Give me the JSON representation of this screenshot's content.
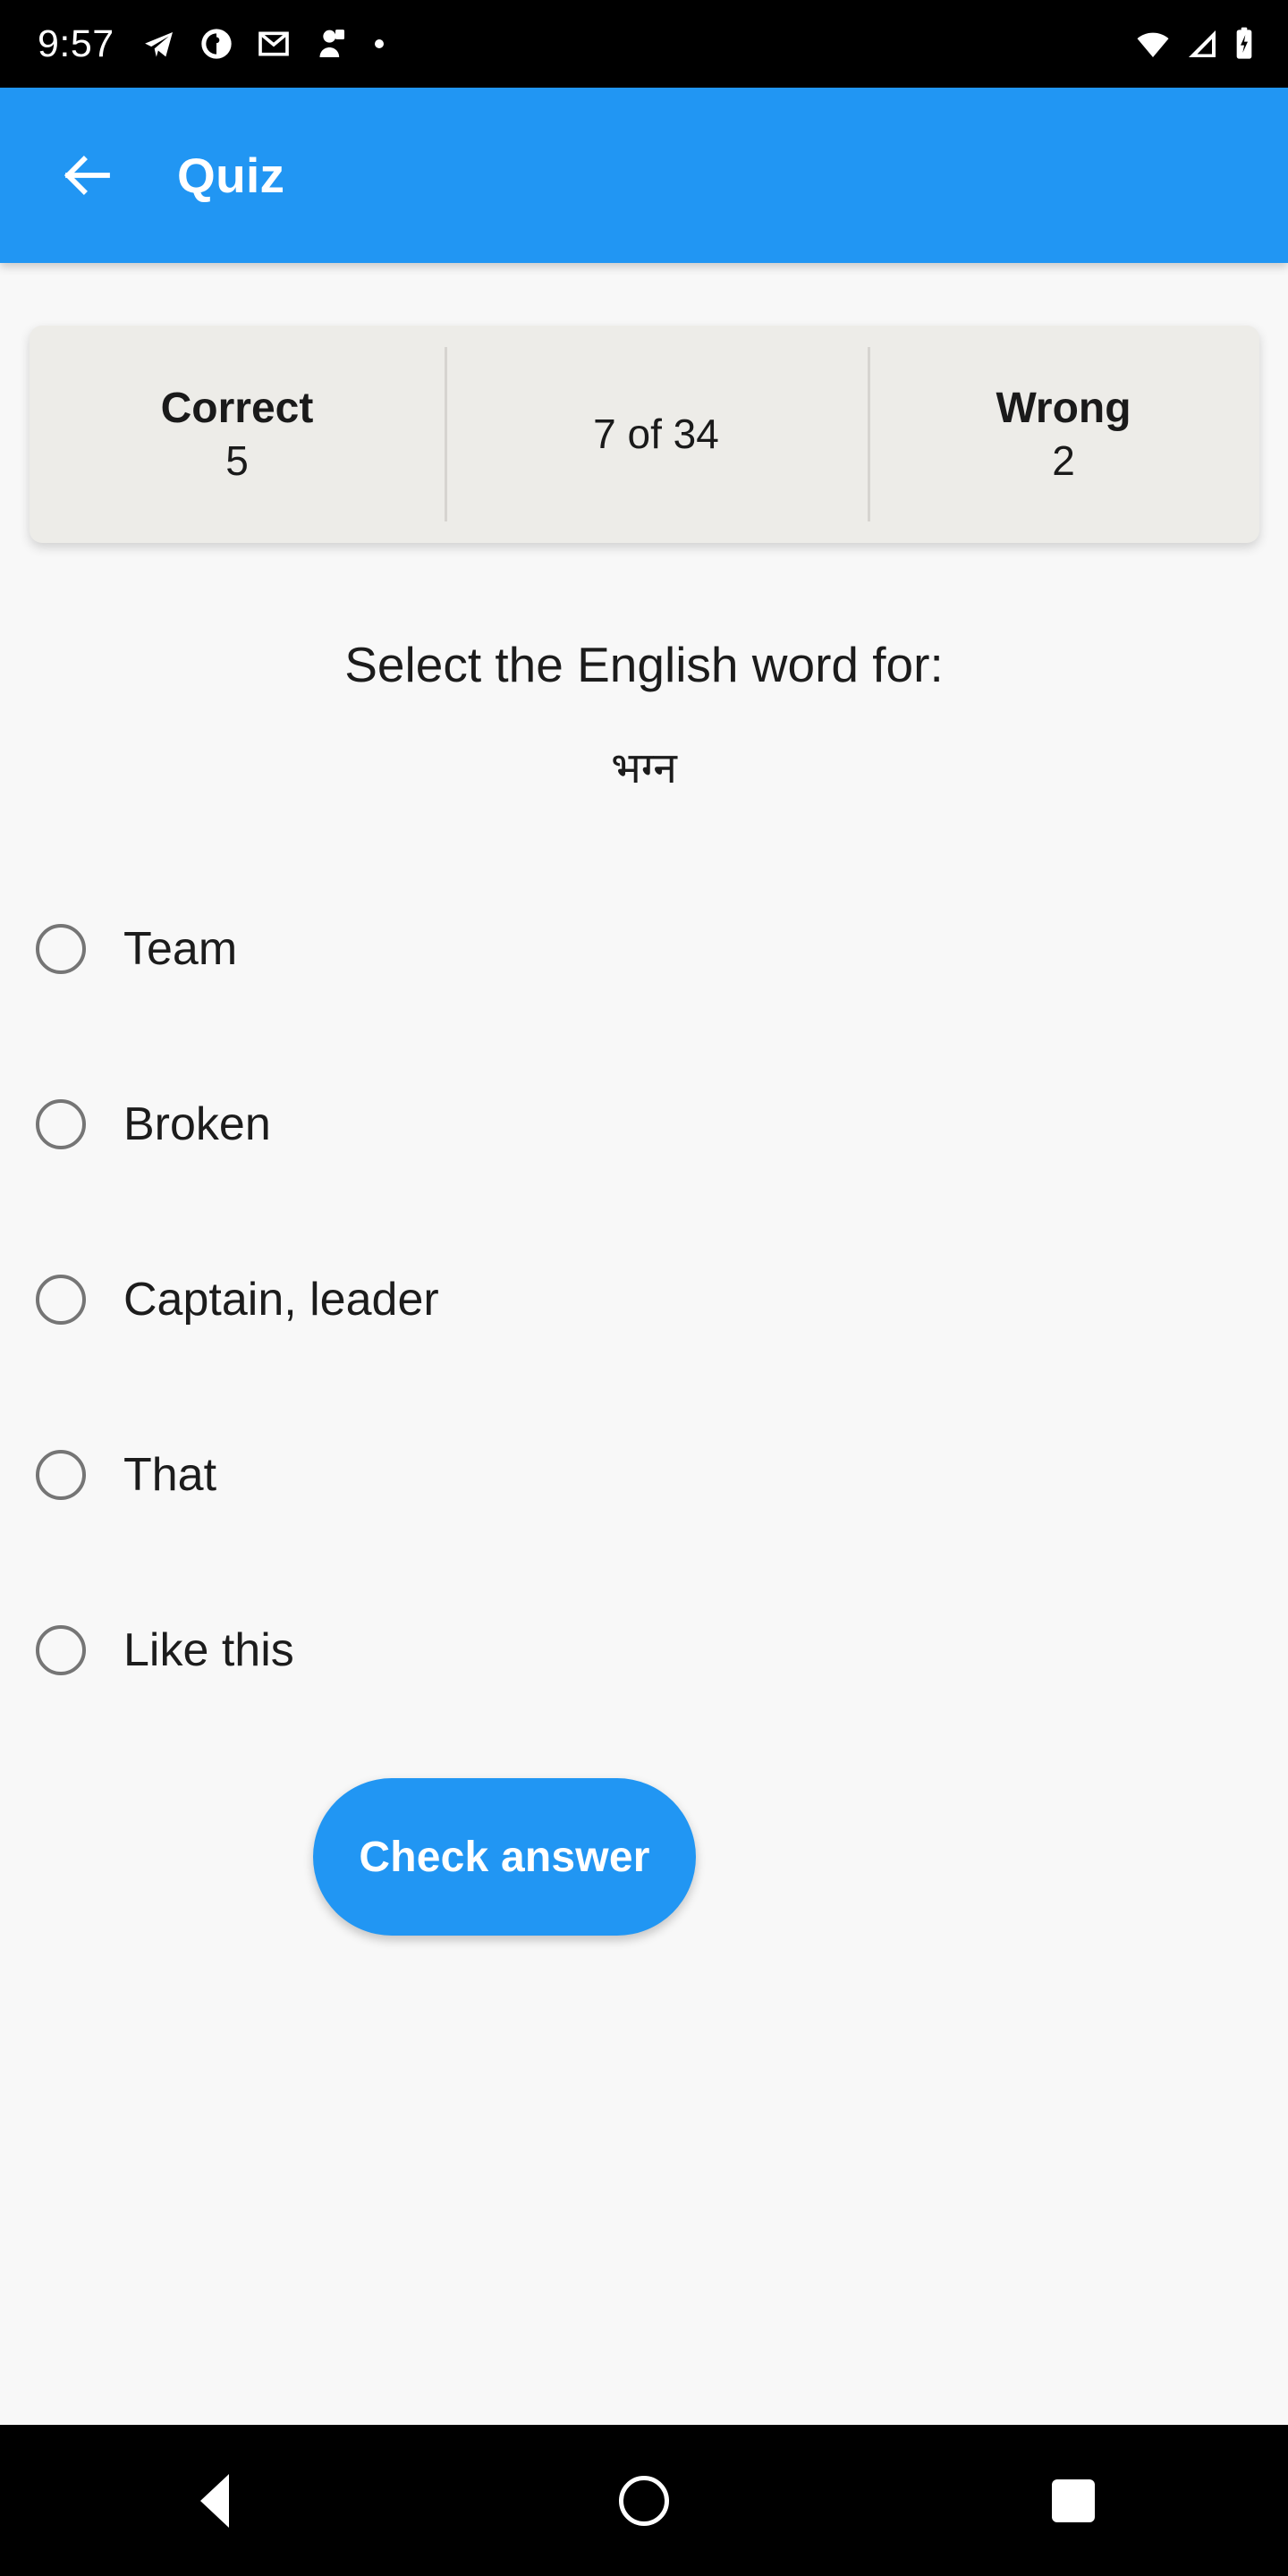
{
  "theme": {
    "accent": "#2196F3",
    "page_bg": "#F8F8F8",
    "card_bg": "#EDECE8",
    "text": "#1C1C1C",
    "radio_stroke": "#757575",
    "divider": "#D6D4D0",
    "statusbar_bg": "#000000",
    "navbar_bg": "#000000"
  },
  "status_bar": {
    "clock": "9:57",
    "left_icons": [
      "telegram-icon",
      "podcast-circle-icon",
      "gmail-icon",
      "contact-person-icon",
      "notification-dot-icon"
    ],
    "right_icons": [
      "wifi-icon",
      "cellular-signal-icon",
      "battery-charging-icon"
    ]
  },
  "app_bar": {
    "back_label": "back-arrow",
    "title": "Quiz"
  },
  "stats": {
    "correct_label": "Correct",
    "correct_value": "5",
    "progress": "7 of 34",
    "wrong_label": "Wrong",
    "wrong_value": "2"
  },
  "question": {
    "prompt": "Select the English word for:",
    "word": "भग्न"
  },
  "options": [
    {
      "label": "Team",
      "selected": false
    },
    {
      "label": "Broken",
      "selected": false
    },
    {
      "label": "Captain, leader",
      "selected": false
    },
    {
      "label": "That",
      "selected": false
    },
    {
      "label": "Like this",
      "selected": false
    }
  ],
  "actions": {
    "check_label": "Check answer"
  },
  "nav_bar": {
    "back": "nav-back-triangle",
    "home": "nav-home-circle",
    "recents": "nav-recents-square"
  }
}
